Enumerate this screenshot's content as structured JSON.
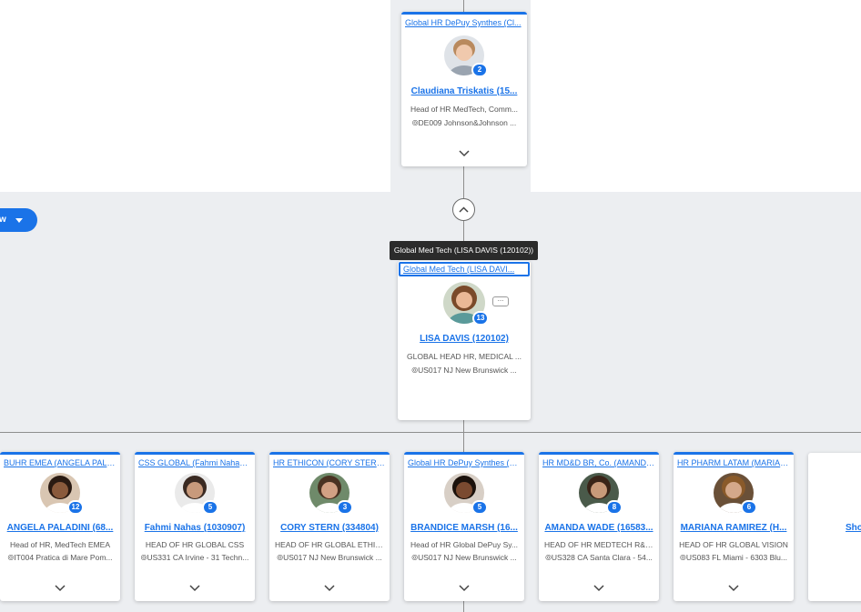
{
  "view_button": {
    "label": "w",
    "icon": "caret-down-icon"
  },
  "tooltip": "Global Med Tech (LISA DAVIS (120102))",
  "top_card": {
    "org": "Global HR DePuy Synthes (Cl...",
    "name": "Claudiana Triskatis (15...",
    "title": "Head of HR MedTech, Comm...",
    "location": "DE009 Johnson&Johnson ...",
    "count": "2"
  },
  "main_card": {
    "org": "Global Med Tech (LISA DAVI...",
    "name": "LISA DAVIS (120102)",
    "title": "GLOBAL HEAD HR, MEDICAL ...",
    "location": "US017 NJ New Brunswick ...",
    "count": "13",
    "more_label": "..."
  },
  "children": [
    {
      "org": "BUHR EMEA (ANGELA PALA...",
      "name": "ANGELA PALADINI (68...",
      "title": "Head of HR, MedTech EMEA",
      "location": "IT004 Pratica di Mare Pom...",
      "count": "12",
      "skin": "#8a5a3c",
      "hair": "#2a1a12",
      "bg": "#d9c6b2"
    },
    {
      "org": "CSS GLOBAL (Fahmi Nahas (...",
      "name": "Fahmi Nahas (1030907)",
      "title": "HEAD OF HR GLOBAL CSS",
      "location": "US331 CA Irvine - 31 Techn...",
      "count": "5",
      "skin": "#c89a7c",
      "hair": "#3a2a22",
      "bg": "#eaeaea"
    },
    {
      "org": "HR ETHICON (CORY STERN (...",
      "name": "CORY STERN (334804)",
      "title": "HEAD OF HR GLOBAL ETHIC...",
      "location": "US017 NJ New Brunswick ...",
      "count": "3",
      "skin": "#d2a184",
      "hair": "#4a3222",
      "bg": "#6f8a6a"
    },
    {
      "org": "Global HR DePuy Synthes (B...",
      "name": "BRANDICE MARSH (16...",
      "title": "Head of HR Global DePuy Sy...",
      "location": "US017 NJ New Brunswick ...",
      "count": "5",
      "skin": "#7a4a30",
      "hair": "#1c120c",
      "bg": "#d8cfc6"
    },
    {
      "org": "HR MD&D BR, Co. (AMANDA ...",
      "name": "AMANDA WADE (16583...",
      "title": "HEAD OF HR MEDTECH R&D ...",
      "location": "US328 CA Santa Clara - 54...",
      "count": "8",
      "skin": "#c99a7a",
      "hair": "#3a2418",
      "bg": "#4a5a4a"
    },
    {
      "org": "HR PHARM LATAM (MARIAN...",
      "name": "MARIANA RAMIREZ (H...",
      "title": "HEAD OF HR GLOBAL VISION",
      "location": "US083 FL Miami - 6303 Blu...",
      "count": "6",
      "skin": "#d4a88a",
      "hair": "#8a5a2a",
      "bg": "#6a5038"
    }
  ],
  "show_more": "Sho",
  "colors": {
    "accent": "#1a73e8",
    "connector": "#8e8e8e",
    "canvas": "#eceef1"
  }
}
